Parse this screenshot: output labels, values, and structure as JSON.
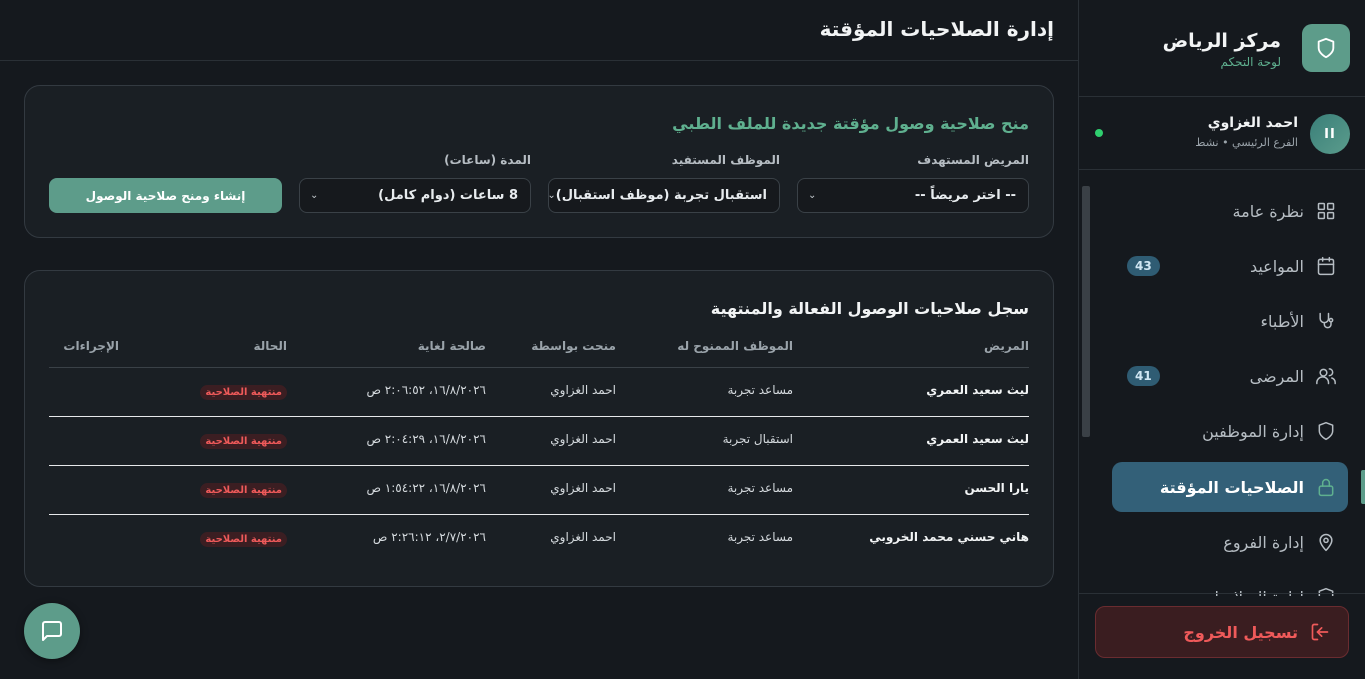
{
  "brand": {
    "name": "مركز الرياض",
    "subtitle": "لوحة التحكم"
  },
  "user": {
    "initials": "II",
    "name": "احمد الغزاوي",
    "subtitle": "الفرع الرئيسي • نشط"
  },
  "nav": {
    "items": [
      {
        "label": "نظرة عامة",
        "icon": "grid-icon"
      },
      {
        "label": "المواعيد",
        "icon": "calendar-icon",
        "badge": "43"
      },
      {
        "label": "الأطباء",
        "icon": "stethoscope-icon"
      },
      {
        "label": "المرضى",
        "icon": "users-icon",
        "badge": "41"
      },
      {
        "label": "إدارة الموظفين",
        "icon": "shield-icon"
      },
      {
        "label": "الصلاحيات المؤقتة",
        "icon": "lock-icon",
        "active": true
      },
      {
        "label": "إدارة الفروع",
        "icon": "map-pin-icon"
      },
      {
        "label": "إدارة الصلاحيات",
        "icon": "shield-icon"
      }
    ]
  },
  "logout_label": "تسجيل الخروج",
  "page_title": "إدارة الصلاحيات المؤقتة",
  "grant_form": {
    "title": "منح صلاحية وصول مؤقتة جديدة للملف الطبي",
    "patient_label": "المريض المستهدف",
    "patient_value": "-- اختر مريضاً --",
    "employee_label": "الموظف المستفيد",
    "employee_value": "استقبال تجربة (موظف استقبال)",
    "duration_label": "المدة (ساعات)",
    "duration_value": "8 ساعات (دوام كامل)",
    "submit_label": "إنشاء ومنح صلاحية الوصول"
  },
  "log": {
    "title": "سجل صلاحيات الوصول الفعالة والمنتهية",
    "columns": {
      "patient": "المريض",
      "employee": "الموظف الممنوح له",
      "granted_by": "منحت بواسطة",
      "valid_until": "صالحة لغاية",
      "status": "الحالة",
      "actions": "الإجراءات"
    },
    "rows": [
      {
        "patient": "ليث سعيد العمري",
        "employee": "مساعد تجربة",
        "granted_by": "احمد الغزاوي",
        "valid_until": "١٦/٨/٢٠٢٦، ٢:٠٦:٥٢ ص",
        "status": "منتهية الصلاحية"
      },
      {
        "patient": "ليث سعيد العمري",
        "employee": "استقبال تجربة",
        "granted_by": "احمد الغزاوي",
        "valid_until": "١٦/٨/٢٠٢٦، ٢:٠٤:٢٩ ص",
        "status": "منتهية الصلاحية"
      },
      {
        "patient": "يارا الحسن",
        "employee": "مساعد تجربة",
        "granted_by": "احمد الغزاوي",
        "valid_until": "١٦/٨/٢٠٢٦، ١:٥٤:٢٢ ص",
        "status": "منتهية الصلاحية"
      },
      {
        "patient": "هاني حسني محمد الخروبي",
        "employee": "مساعد تجربة",
        "granted_by": "احمد الغزاوي",
        "valid_until": "٢/٧/٢٠٢٦، ٢:٢٦:١٢ ص",
        "status": "منتهية الصلاحية"
      }
    ]
  },
  "colors": {
    "accent": "#5d9c8a",
    "active_nav": "#336078",
    "danger": "#ef5a5a",
    "background": "#15191e"
  }
}
